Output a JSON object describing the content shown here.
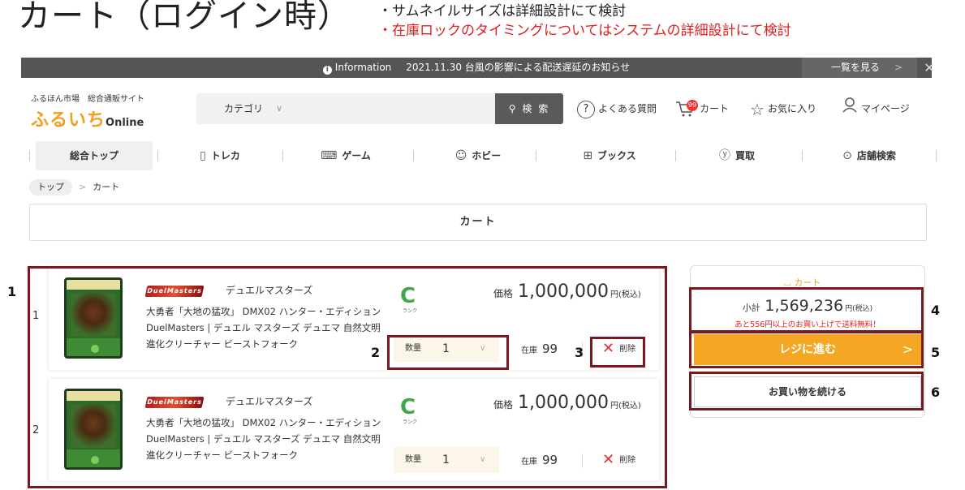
{
  "page": {
    "title": "カート（ログイン時）",
    "notes": [
      "・サムネイルサイズは詳細設計にて検討",
      "・在庫ロックのタイミングについてはシステムの詳細設計にて検討"
    ]
  },
  "info_bar": {
    "label": "Information",
    "message": "2021.11.30 台風の影響による配送遅延のお知らせ",
    "view_all": "一覧を見る"
  },
  "header": {
    "site_sub": "ふるほん市場　総合通販サイト",
    "logo_main": "ふるいち",
    "logo_sub": "Online",
    "category_label": "カテゴリ",
    "search_placeholder": "",
    "search_button": "検 索",
    "faq": "よくある質問",
    "cart": "カート",
    "cart_badge": "99",
    "favorites": "お気に入り",
    "mypage": "マイページ"
  },
  "nav": {
    "items": [
      {
        "label": "総合トップ",
        "icon": ""
      },
      {
        "label": "トレカ",
        "icon": "card-icon"
      },
      {
        "label": "ゲーム",
        "icon": "gamepad-icon"
      },
      {
        "label": "ホビー",
        "icon": "hobby-icon"
      },
      {
        "label": "ブックス",
        "icon": "book-icon"
      },
      {
        "label": "買取",
        "icon": "yen-icon"
      },
      {
        "label": "店舗検索",
        "icon": "pin-icon"
      }
    ]
  },
  "breadcrumb": {
    "home": "トップ",
    "current": "カート"
  },
  "cart_heading": "カート",
  "items": [
    {
      "num": "1",
      "series": "デュエルマスターズ",
      "series_logo": "DuelMasters",
      "description": "大勇者「大地の猛攻」 DMX02 ハンター・エディション DuelMasters | デュエル マスターズ デュエマ 自然文明 進化クリーチャー ビーストフォーク",
      "rank": "C",
      "rank_label": "ランク",
      "price_label": "価格",
      "price": "1,000,000",
      "price_unit": "円(税込)",
      "qty_label": "数量",
      "qty": "1",
      "stock_label": "在庫",
      "stock": "99",
      "delete_label": "削除"
    },
    {
      "num": "2",
      "series": "デュエルマスターズ",
      "series_logo": "DuelMasters",
      "description": "大勇者「大地の猛攻」 DMX02 ハンター・エディション DuelMasters | デュエル マスターズ デュエマ 自然文明 進化クリーチャー ビーストフォーク",
      "rank": "C",
      "rank_label": "ランク",
      "price_label": "価格",
      "price": "1,000,000",
      "price_unit": "円(税込)",
      "qty_label": "数量",
      "qty": "1",
      "stock_label": "在庫",
      "stock": "99",
      "delete_label": "削除"
    }
  ],
  "side": {
    "cart_label": "カート",
    "subtotal_label": "小計",
    "subtotal": "1,569,236",
    "subtotal_unit": "円(税込)",
    "free_shipping": "あと556円以上のお買い上げで送料無料！",
    "checkout": "レジに進む",
    "continue": "お買い物を続ける"
  },
  "annotations": [
    "1",
    "2",
    "3",
    "4",
    "5",
    "6"
  ],
  "colors": {
    "accent": "#f5a623",
    "annotation_border": "#7a1820",
    "alert": "#e02020"
  }
}
